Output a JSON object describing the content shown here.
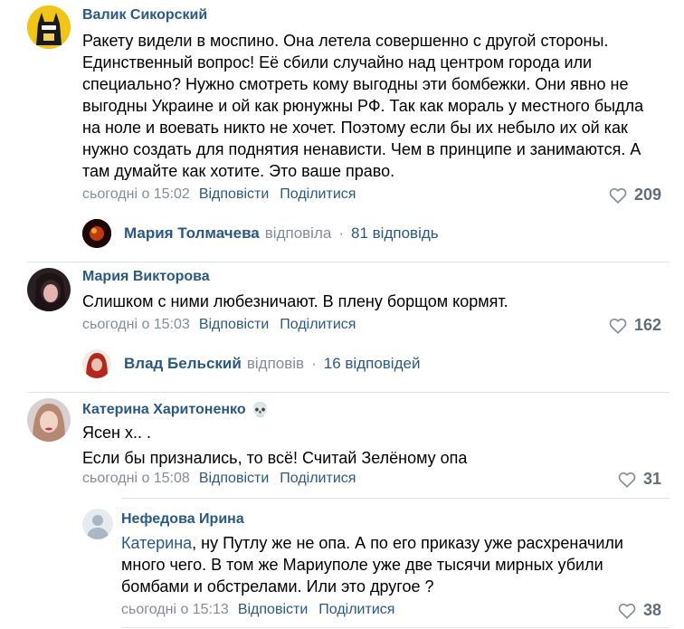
{
  "comments": [
    {
      "author": "Валик Сикорский",
      "lines": [
        "Ракету видели в моспино. Она летела совершенно с другой стороны.",
        "Единственный вопрос! Её сбили случайно над центром города или",
        "специально? Нужно смотреть кому выгодны эти бомбежки. Они явно не",
        "выгодны Украине и ой как рюнужны РФ. Так как мораль у местного быдла",
        "на ноле и воевать никто не хочет. Поэтому если бы их небыло их ой как",
        "нужно создать для поднятия ненависти. Чем в принципе и занимаются. А",
        "там думайте как хотите. Это ваше право."
      ],
      "time": "сьогодні о 15:02",
      "reply": "Відповісти",
      "share": "Поділитися",
      "likes": "209",
      "thread": {
        "name": "Мария Толмачева",
        "verb": "відповіла",
        "dot": "·",
        "count": "81 відповідь"
      }
    },
    {
      "author": "Мария Викторова",
      "lines": [
        "Слишком с ними любезничают. В плену борщом кормят."
      ],
      "time": "сьогодні о 15:03",
      "reply": "Відповісти",
      "share": "Поділитися",
      "likes": "162",
      "thread": {
        "name": "Влад Бельский",
        "verb": "відповів",
        "dot": "·",
        "count": "16 відповідей"
      }
    },
    {
      "author": "Катерина Харитоненко",
      "badge": "💀",
      "lines": [
        "Ясен х.. .",
        "Если бы признались, то всё! Считай Зелёному опа"
      ],
      "time": "сьогодні о 15:08",
      "reply": "Відповісти",
      "share": "Поділитися",
      "likes": "31"
    }
  ],
  "nested_reply": {
    "author": "Нефедова Ирина",
    "mention": "Катерина",
    "first_line_rest": ", ну Путлу же не опа. А по его приказу уже расхреначили",
    "lines": [
      "много чего. В том же Мариуполе уже две тысячи мирных убили",
      "бомбами и обстрелами. Или это другое ?"
    ],
    "time": "сьогодні о 15:13",
    "reply": "Відповісти",
    "share": "Поділитися",
    "likes": "38"
  },
  "icons": {
    "like": "heart-outline-icon"
  },
  "colors": {
    "link": "#2a5885",
    "meta": "#818c99",
    "divider": "#dce1e6"
  }
}
